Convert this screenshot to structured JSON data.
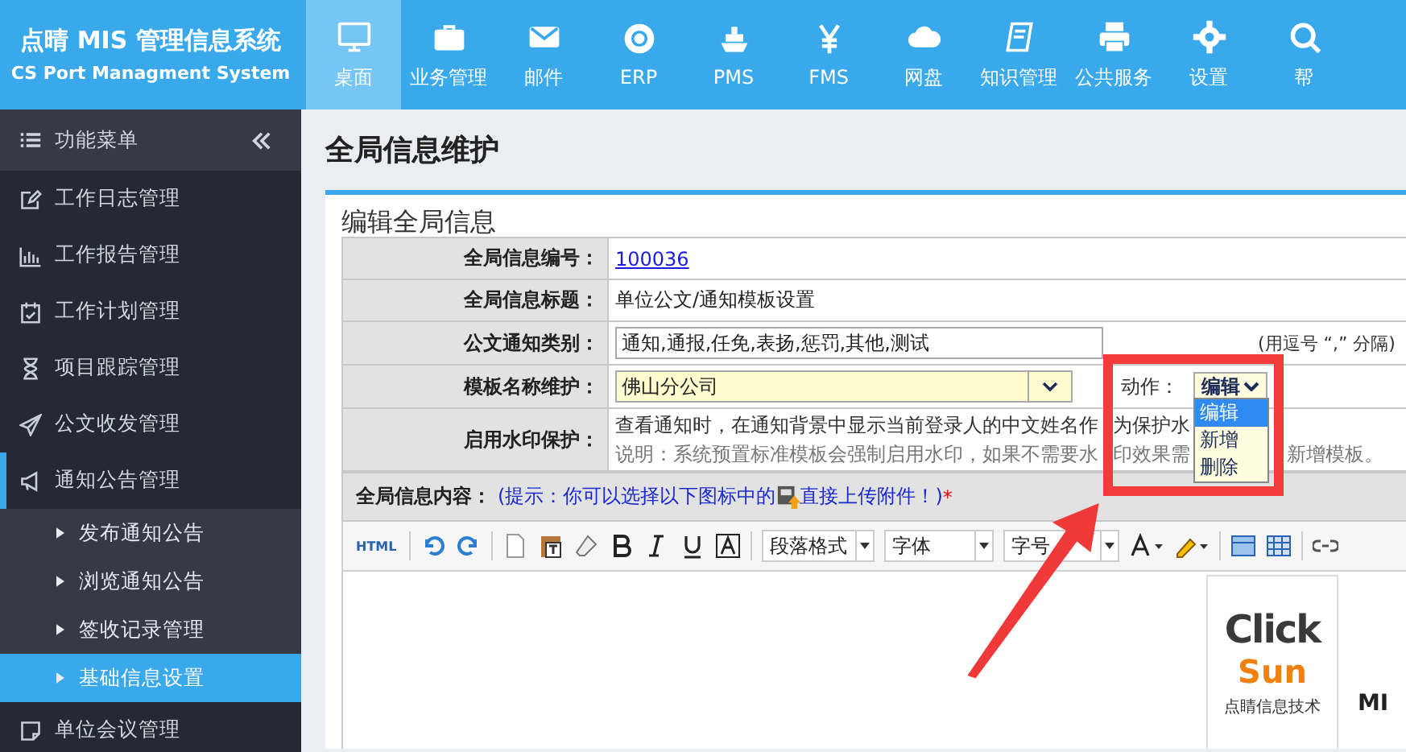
{
  "header": {
    "logo_title": "点晴 MIS 管理信息系统",
    "logo_subtitle": "CS Port Managment System",
    "nav": [
      {
        "label": "桌面",
        "selected": true
      },
      {
        "label": "业务管理",
        "selected": false
      },
      {
        "label": "邮件",
        "selected": false
      },
      {
        "label": "ERP",
        "selected": false
      },
      {
        "label": "PMS",
        "selected": false
      },
      {
        "label": "FMS",
        "selected": false
      },
      {
        "label": "网盘",
        "selected": false
      },
      {
        "label": "知识管理",
        "selected": false
      },
      {
        "label": "公共服务",
        "selected": false
      },
      {
        "label": "设置",
        "selected": false
      },
      {
        "label": "帮",
        "selected": false
      }
    ]
  },
  "sidebar": {
    "title": "功能菜单",
    "items": [
      {
        "label": "工作日志管理",
        "expanded": false
      },
      {
        "label": "工作报告管理",
        "expanded": false
      },
      {
        "label": "工作计划管理",
        "expanded": false
      },
      {
        "label": "项目跟踪管理",
        "expanded": false
      },
      {
        "label": "公文收发管理",
        "expanded": false
      },
      {
        "label": "通知公告管理",
        "expanded": true,
        "children": [
          {
            "label": "发布通知公告",
            "selected": false
          },
          {
            "label": "浏览通知公告",
            "selected": false
          },
          {
            "label": "签收记录管理",
            "selected": false
          },
          {
            "label": "基础信息设置",
            "selected": true
          }
        ]
      },
      {
        "label": "单位会议管理",
        "expanded": false
      }
    ]
  },
  "page": {
    "title": "全局信息维护",
    "section_title": "编辑全局信息",
    "rows": [
      {
        "kind": "link",
        "label": "全局信息编号：",
        "value": "100036"
      },
      {
        "kind": "text",
        "label": "全局信息标题：",
        "value": "单位公文/通知模板设置"
      },
      {
        "kind": "input",
        "label": "公文通知类别：",
        "value": "通知,通报,任免,表扬,惩罚,其他,测试",
        "suffix": "(用逗号 “,” 分隔)"
      },
      {
        "kind": "select",
        "label": "模板名称维护：",
        "value": "佛山分公司"
      },
      {
        "kind": "notes",
        "label": "启用水印保护：",
        "value": "查看通知时，在通知背景中显示当前登录人的中文姓名作",
        "value_inner": "为保护水",
        "note": "说明：系统预置标准模板会强制启用水印，如果不需要水",
        "note_inner": "印效果需",
        "note_tail": "新增模板。"
      }
    ],
    "action": {
      "label": "动作：",
      "value": "编辑",
      "options": [
        {
          "label": "编辑",
          "selected": true
        },
        {
          "label": "新增",
          "selected": false
        },
        {
          "label": "删除",
          "selected": false
        }
      ]
    },
    "content": {
      "label": "全局信息内容：",
      "hint": "(提示：你可以选择以下图标中的",
      "hint_tail": "直接上传附件！)",
      "required": "*"
    },
    "toolbar": {
      "html": "HTML",
      "selects": [
        "段落格式",
        "字体",
        "字号"
      ]
    },
    "logo": {
      "word1": "Click",
      "word2": "Sun",
      "caption": "点睛信息技术",
      "cut_text": "MI"
    }
  }
}
